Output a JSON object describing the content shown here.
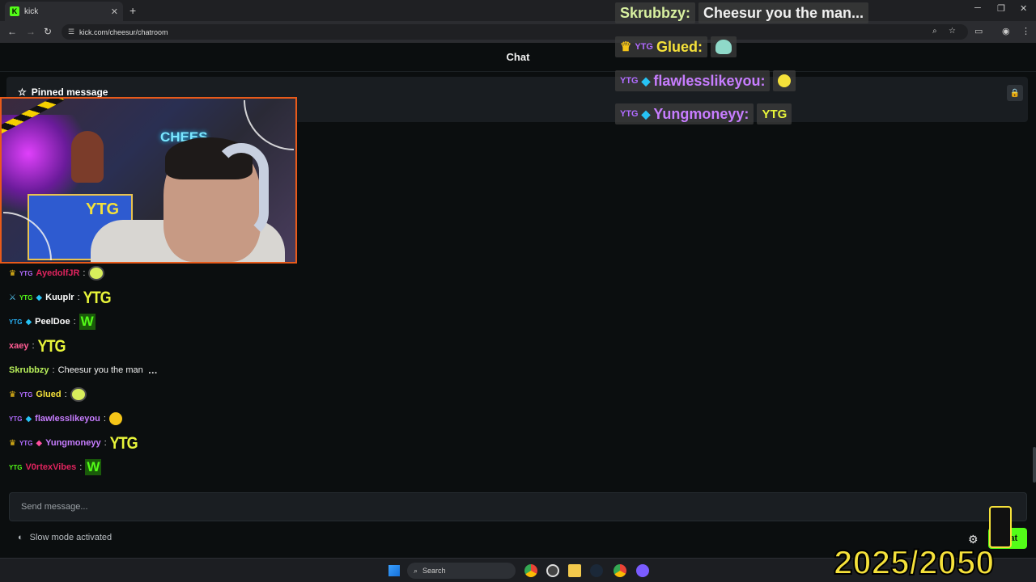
{
  "browser": {
    "tab_title": "kick",
    "url": "kick.com/cheesur/chatroom",
    "favicon_letter": "K"
  },
  "chat": {
    "header_title": "Chat",
    "pinned_title": "Pinned message",
    "send_placeholder": "Send message...",
    "slow_mode": "Slow mode activated",
    "chat_button_label": "Chat",
    "messages": [
      {
        "username": "AyedolfJR",
        "color": "#e0245e"
      },
      {
        "username": "Kuuplr",
        "color": "#ffffff"
      },
      {
        "username": "PeelDoe",
        "color": "#ffffff"
      },
      {
        "username": "xaey",
        "color": "#ff5c93"
      },
      {
        "username": "Skrubbzy",
        "color": "#b8f05a",
        "text": "Cheesur you the man"
      },
      {
        "username": "Glued",
        "color": "#f5e13a"
      },
      {
        "username": "flawlesslikeyou",
        "color": "#c77dff"
      },
      {
        "username": "Yungmoneyy",
        "color": "#c77dff"
      },
      {
        "username": "V0rtexVibes",
        "color": "#e0245e"
      }
    ]
  },
  "overlay": {
    "lines": [
      {
        "username": "Skrubbzy:",
        "color": "#d8f0a0",
        "text": "Cheesur you the man..."
      },
      {
        "username": "Glued:",
        "color": "#f5e13a"
      },
      {
        "username": "flawlesslikeyou:",
        "color": "#c77dff"
      },
      {
        "username": "Yungmoneyy:",
        "color": "#c77dff"
      }
    ],
    "ytg_emote": "YTG",
    "w_emote": "W",
    "neon_sign": "CHEES",
    "poster_text": "YTG"
  },
  "taskbar": {
    "search_label": "Search"
  },
  "counter": "2025/2050"
}
